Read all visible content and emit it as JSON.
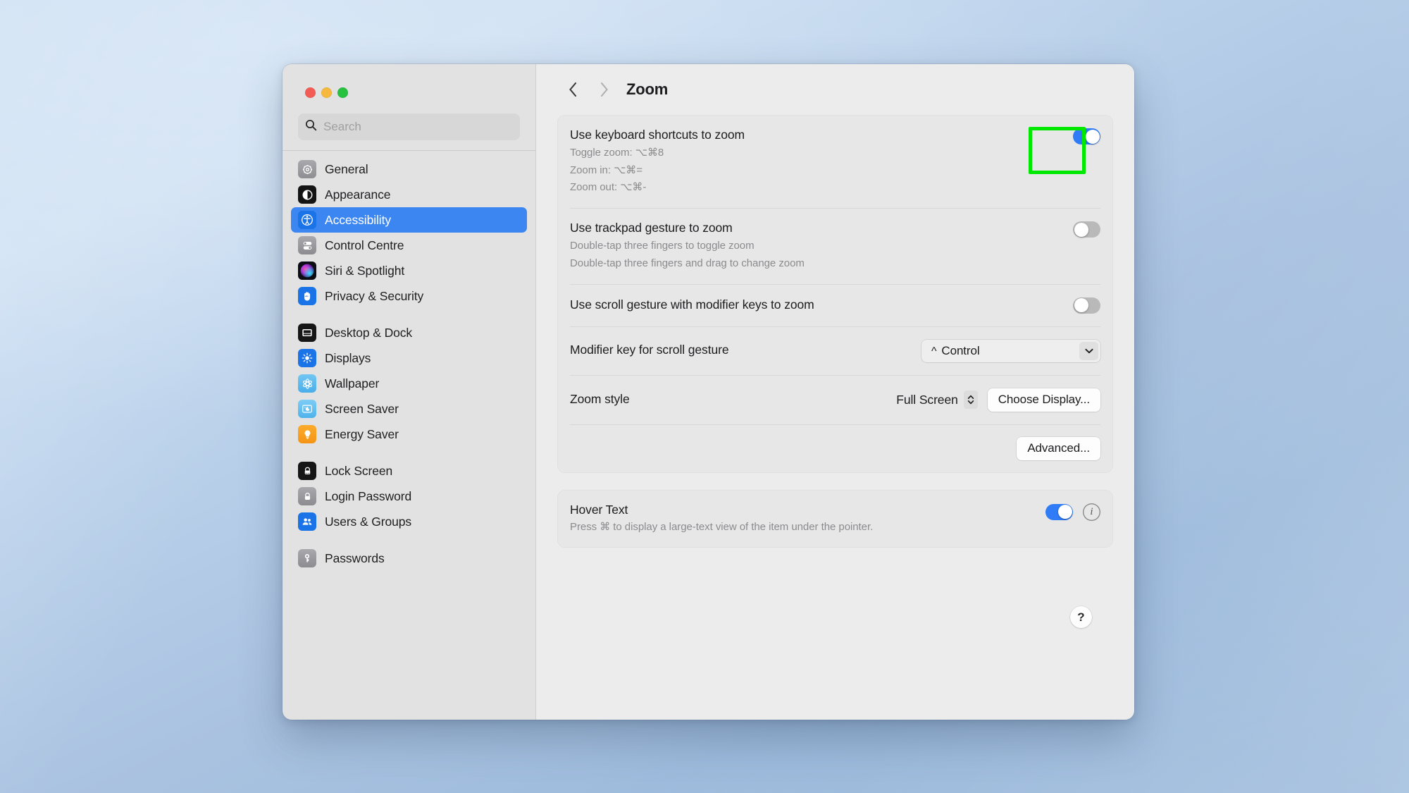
{
  "window": {
    "traffic_lights": [
      "close",
      "minimize",
      "maximize"
    ],
    "colors": {
      "close": "#f35c54",
      "minimize": "#f6b93e",
      "maximize": "#27c13f",
      "accent": "#3c86f2",
      "toggle_on": "#2f7cf6",
      "highlight": "#00e800"
    }
  },
  "search": {
    "placeholder": "Search",
    "value": ""
  },
  "sidebar": {
    "groups": [
      {
        "items": [
          {
            "label": "General",
            "icon": "gear-icon"
          },
          {
            "label": "Appearance",
            "icon": "appearance-icon"
          },
          {
            "label": "Accessibility",
            "icon": "accessibility-icon",
            "selected": true
          },
          {
            "label": "Control Centre",
            "icon": "control-centre-icon"
          },
          {
            "label": "Siri & Spotlight",
            "icon": "siri-icon"
          },
          {
            "label": "Privacy & Security",
            "icon": "privacy-hand-icon"
          }
        ]
      },
      {
        "items": [
          {
            "label": "Desktop & Dock",
            "icon": "desktop-dock-icon"
          },
          {
            "label": "Displays",
            "icon": "displays-icon"
          },
          {
            "label": "Wallpaper",
            "icon": "wallpaper-icon"
          },
          {
            "label": "Screen Saver",
            "icon": "screen-saver-icon"
          },
          {
            "label": "Energy Saver",
            "icon": "energy-saver-icon"
          }
        ]
      },
      {
        "items": [
          {
            "label": "Lock Screen",
            "icon": "lock-screen-icon"
          },
          {
            "label": "Login Password",
            "icon": "login-password-icon"
          },
          {
            "label": "Users & Groups",
            "icon": "users-groups-icon"
          }
        ]
      },
      {
        "items": [
          {
            "label": "Passwords",
            "icon": "passwords-key-icon"
          }
        ]
      }
    ]
  },
  "toolbar": {
    "back_label": "back-chevron",
    "forward_label": "forward-chevron",
    "title": "Zoom"
  },
  "zoom_card": {
    "keyboard_shortcuts": {
      "title": "Use keyboard shortcuts to zoom",
      "lines": [
        "Toggle zoom: ⌥⌘8",
        "Zoom in: ⌥⌘=",
        "Zoom out: ⌥⌘-"
      ],
      "toggle": "on",
      "highlighted": true
    },
    "trackpad_gesture": {
      "title": "Use trackpad gesture to zoom",
      "lines": [
        "Double-tap three fingers to toggle zoom",
        "Double-tap three fingers and drag to change zoom"
      ],
      "toggle": "off"
    },
    "scroll_gesture": {
      "title": "Use scroll gesture with modifier keys to zoom",
      "toggle": "off"
    },
    "modifier_key": {
      "title": "Modifier key for scroll gesture",
      "value_symbol": "^",
      "value": "Control"
    },
    "zoom_style": {
      "title": "Zoom style",
      "value": "Full Screen",
      "button": "Choose Display..."
    },
    "advanced_button": "Advanced..."
  },
  "hover_text_card": {
    "title": "Hover Text",
    "subtitle": "Press ⌘ to display a large-text view of the item under the pointer.",
    "toggle": "on",
    "info_label": "i"
  },
  "help": {
    "label": "?"
  }
}
